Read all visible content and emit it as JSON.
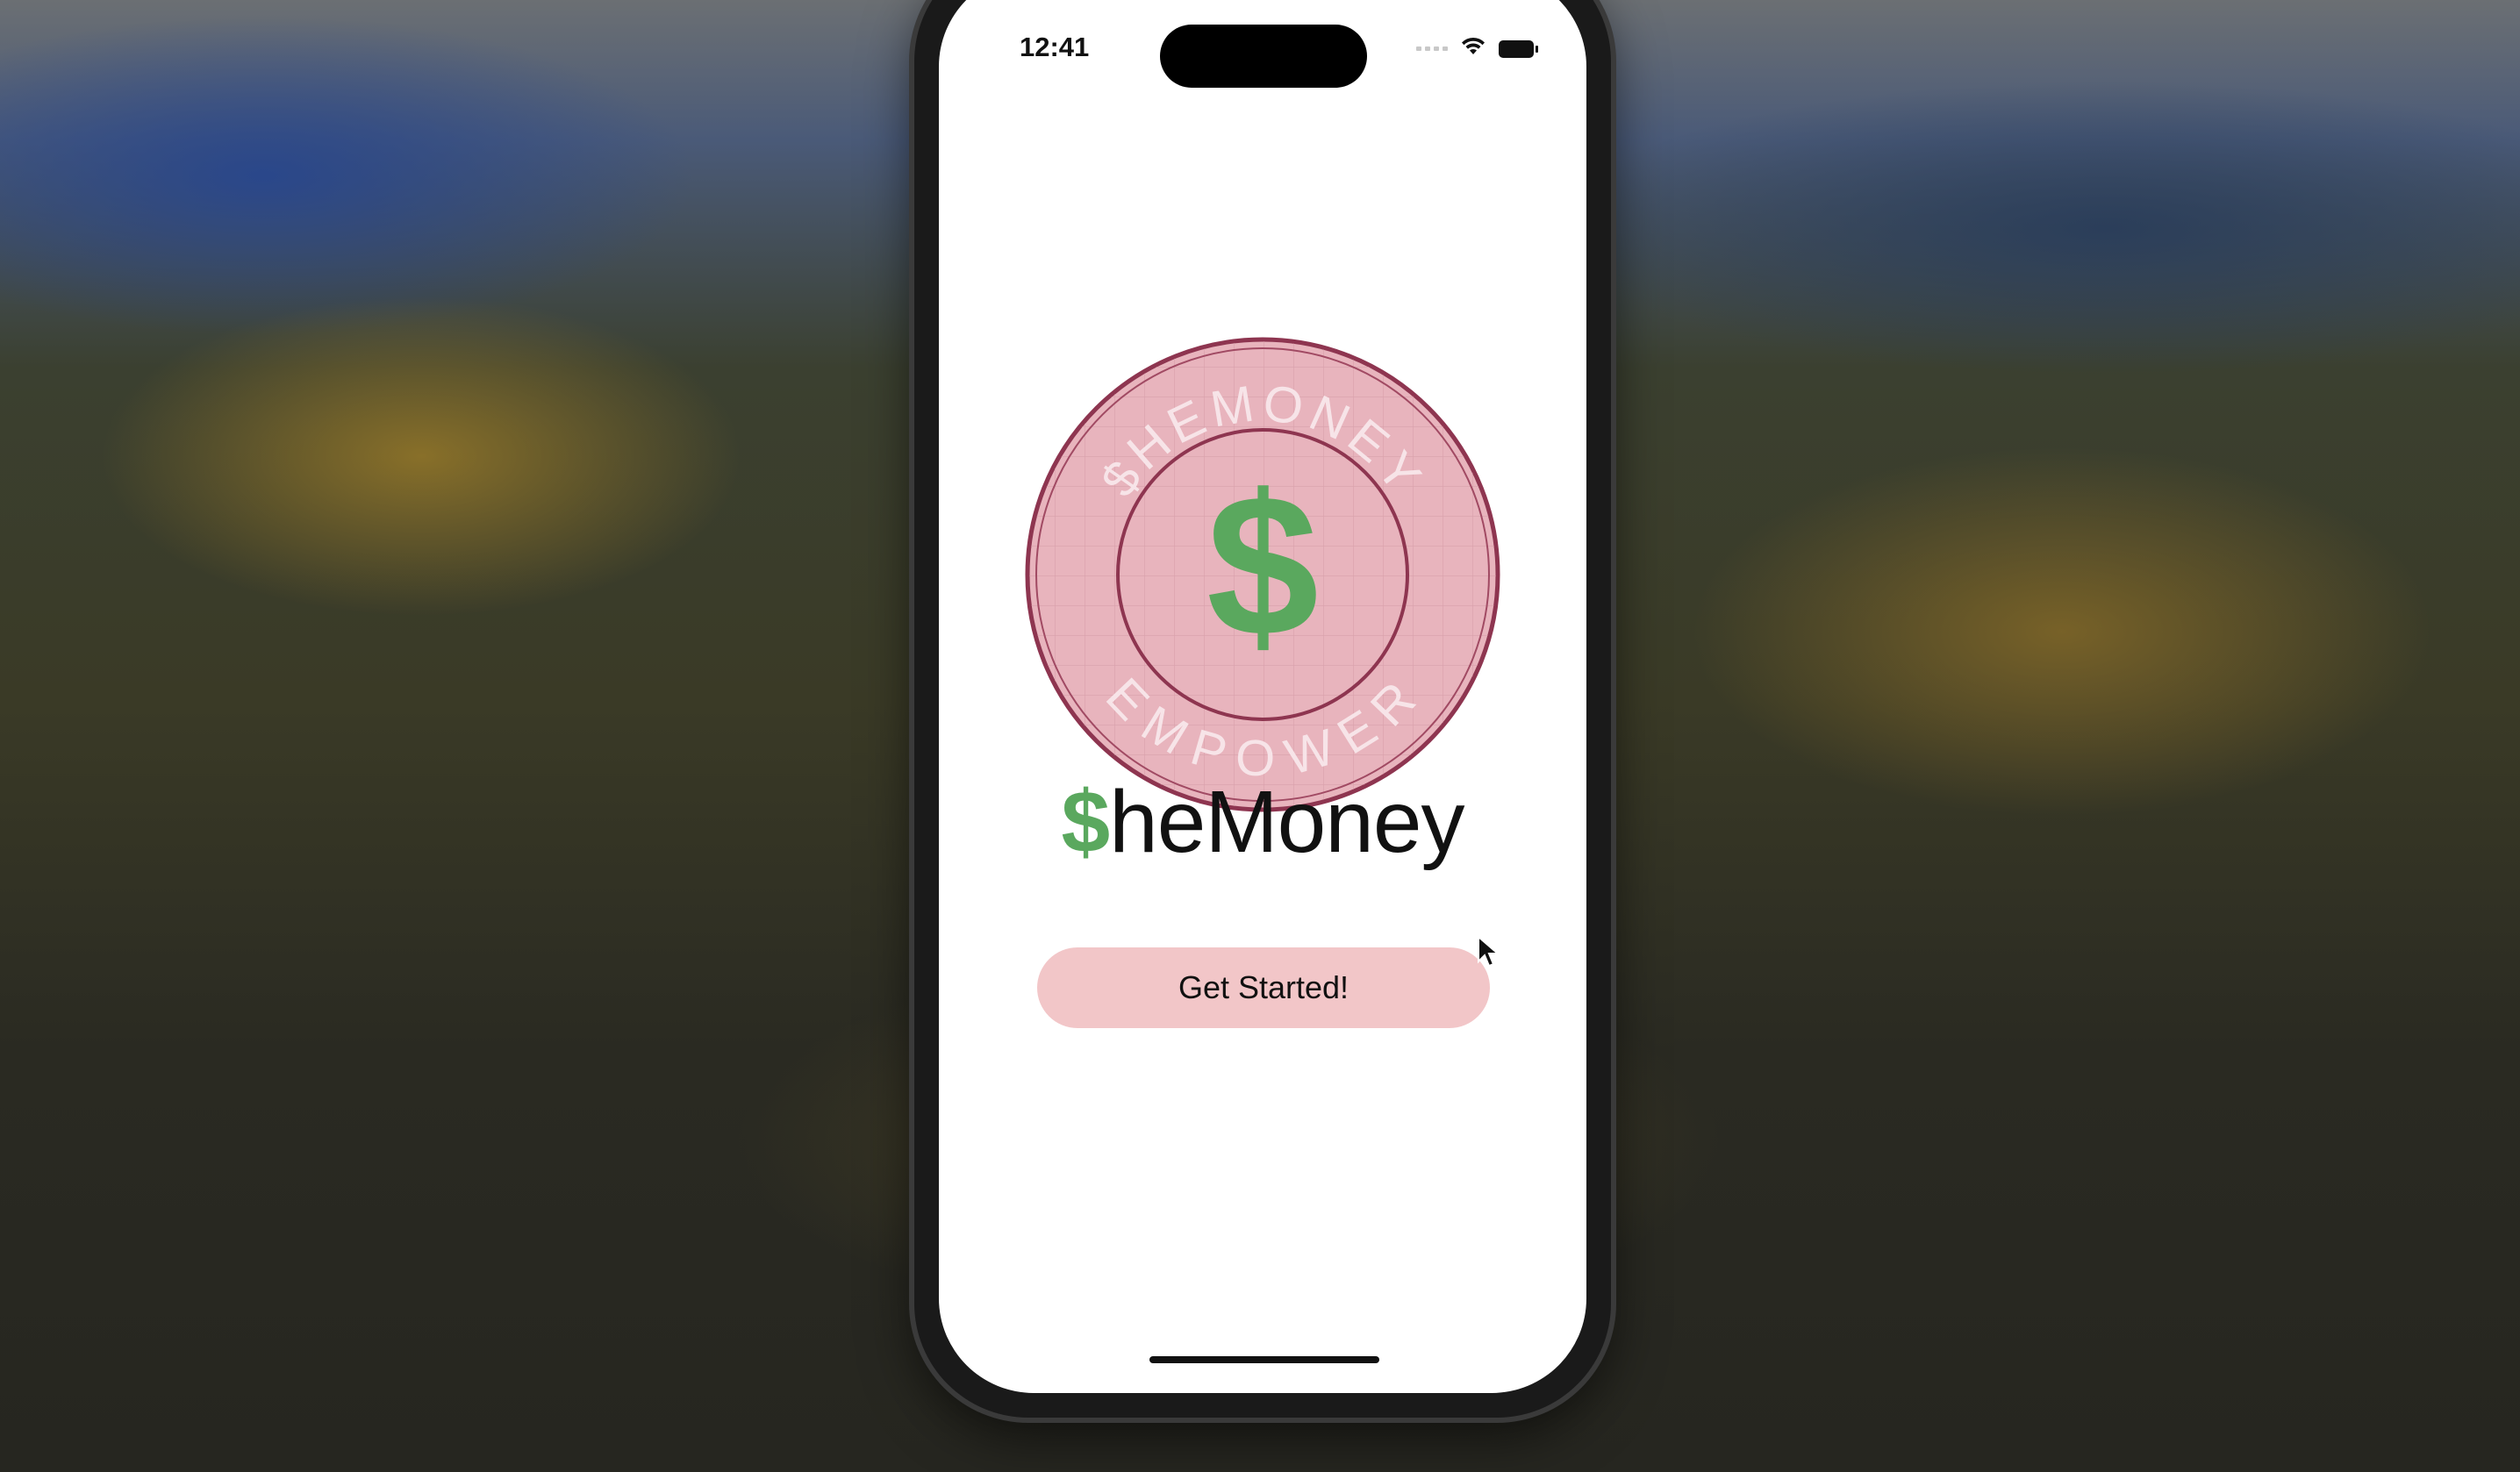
{
  "status_bar": {
    "time": "12:41",
    "icons": [
      "cellular-signal-icon",
      "wifi-icon",
      "battery-icon"
    ]
  },
  "logo": {
    "ring_text_top": "$HEMONEY",
    "ring_text_bottom": "EMPOWER",
    "center_symbol": "$",
    "colors": {
      "coin_fill": "#e8b4bd",
      "coin_border": "#8e3550",
      "symbol": "#5aa85e",
      "ring_text": "#f7e4e8"
    }
  },
  "app_title": {
    "prefix": "$",
    "rest": "heMoney"
  },
  "get_started_button": {
    "label": "Get Started!"
  },
  "colors": {
    "button_bg": "#f2c6c8",
    "accent_green": "#5aa85e",
    "screen_bg": "#ffffff"
  }
}
